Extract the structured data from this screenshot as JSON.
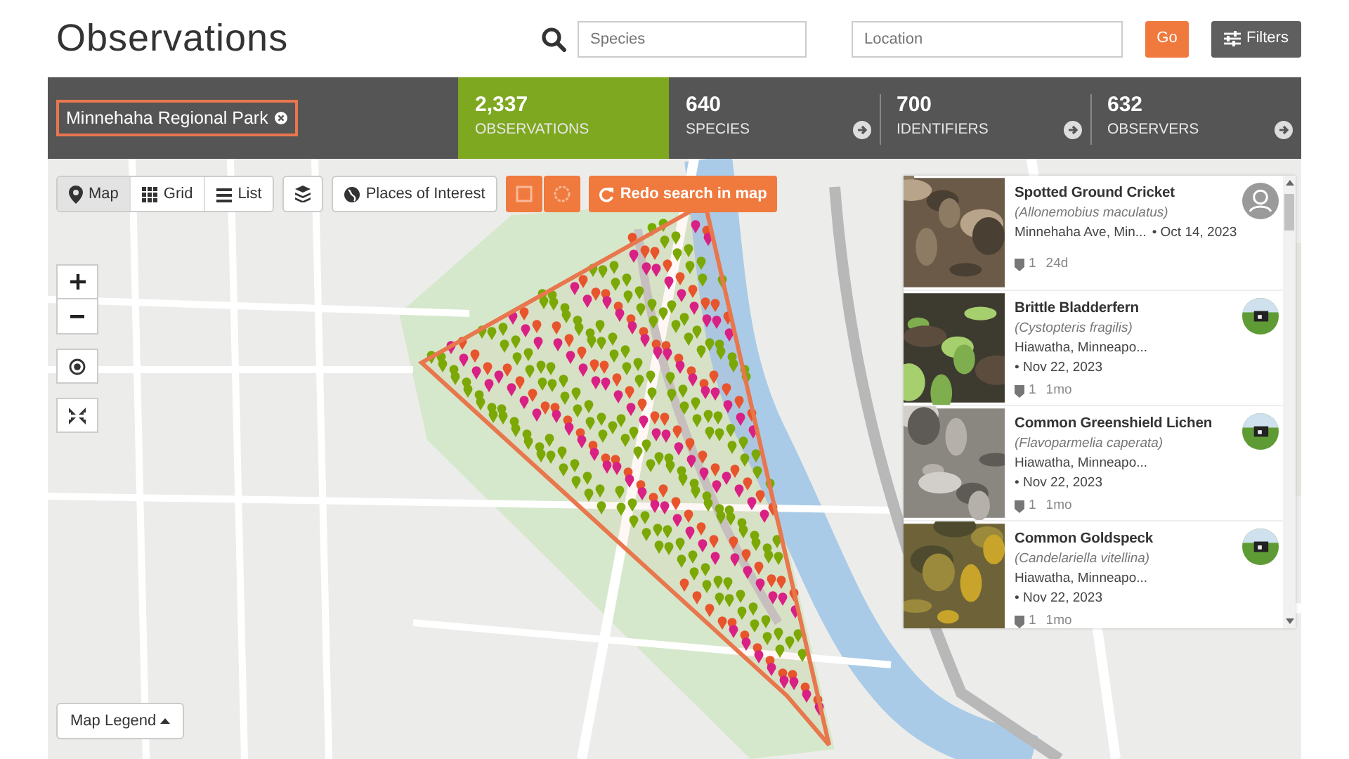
{
  "page_title": "Observations",
  "search": {
    "species_placeholder": "Species",
    "location_placeholder": "Location",
    "go_label": "Go",
    "filters_label": "Filters"
  },
  "place_filter": {
    "label": "Minnehaha Regional Park"
  },
  "stats": [
    {
      "count": "2,337",
      "label": "OBSERVATIONS",
      "selected": true
    },
    {
      "count": "640",
      "label": "SPECIES",
      "selected": false
    },
    {
      "count": "700",
      "label": "IDENTIFIERS",
      "selected": false
    },
    {
      "count": "632",
      "label": "OBSERVERS",
      "selected": false
    }
  ],
  "view_tabs": [
    {
      "label": "Map",
      "selected": true
    },
    {
      "label": "Grid",
      "selected": false
    },
    {
      "label": "List",
      "selected": false
    }
  ],
  "map_buttons": {
    "places_label": "Places of Interest",
    "redo_label": "Redo search in map",
    "legend_label": "Map Legend"
  },
  "observations": [
    {
      "title": "Spotted Ground Cricket",
      "scientific_name": "(Allonemobius maculatus)",
      "place": "Minnehaha Ave, Min...",
      "date": "• Oct 14, 2023",
      "comments": "1",
      "age": "24d",
      "kind": "default"
    },
    {
      "title": "Brittle Bladderfern",
      "scientific_name": "(Cystopteris fragilis)",
      "place": "Hiawatha, Minneapo...",
      "date": "• Nov 22, 2023",
      "comments": "1",
      "age": "1mo"
    },
    {
      "title": "Common Greenshield Lichen",
      "scientific_name": "(Flavoparmelia caperata)",
      "place": "Hiawatha, Minneapo...",
      "date": "• Nov 22, 2023",
      "comments": "1",
      "age": "1mo"
    },
    {
      "title": "Common Goldspeck",
      "scientific_name": "(Candelariella vitellina)",
      "place": "Hiawatha, Minneapo...",
      "date": "• Nov 22, 2023",
      "comments": "1",
      "age": "1mo"
    }
  ]
}
